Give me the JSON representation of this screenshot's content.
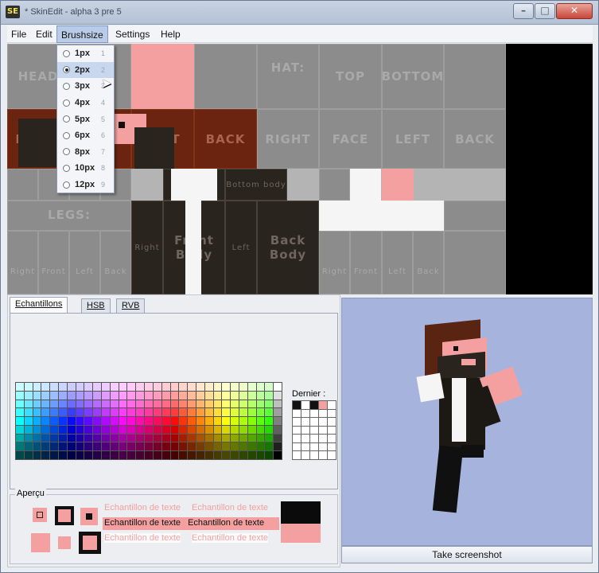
{
  "window": {
    "app_icon": "SE",
    "title": "* SkinEdit - alpha 3 pre 5",
    "minimize": "–",
    "maximize": "□",
    "close": "✕"
  },
  "menubar": {
    "items": [
      "File",
      "Edit",
      "Brushsize",
      "Settings",
      "Help"
    ]
  },
  "brush_menu": {
    "items": [
      {
        "label": "1px",
        "key": "1"
      },
      {
        "label": "2px",
        "key": "2",
        "selected": true
      },
      {
        "label": "3px",
        "key": "3"
      },
      {
        "label": "4px",
        "key": "4"
      },
      {
        "label": "5px",
        "key": "5"
      },
      {
        "label": "6px",
        "key": "6"
      },
      {
        "label": "8px",
        "key": "7"
      },
      {
        "label": "10px",
        "key": "8"
      },
      {
        "label": "12px",
        "key": "9"
      }
    ]
  },
  "skin_labels": {
    "head": "HEAD",
    "hat": "HAT:",
    "top": "TOP",
    "bottom": "BOTTOM",
    "right": "RIGHT",
    "left": "LEFT",
    "back": "BACK",
    "face": "FACE",
    "right2": "RIGHT",
    "left2": "LEFT",
    "back2": "BACK",
    "legs": "LEGS:",
    "bottom_body": "Bottom body",
    "front_body": "Front Body",
    "back_body": "Back Body",
    "body_right": "Right",
    "body_left": "Left",
    "leg_right": "Right",
    "leg_front": "Front",
    "leg_left": "Left",
    "leg_back": "Back",
    "arm_right": "Right",
    "arm_front": "Front",
    "arm_left": "Left",
    "arm_back": "Back"
  },
  "color_panel": {
    "tabs": [
      "Echantillons",
      "HSB",
      "RVB"
    ],
    "recent_label": "Dernier :",
    "apercu_label": "Aperçu",
    "sample_text": "Echantillon de texte"
  },
  "preview": {
    "screenshot_button": "Take screenshot"
  },
  "colors": {
    "skin_pink": "#f4a0a0",
    "shirt_brown": "#6b2410",
    "suit_dark": "#2a241f",
    "preview_bg": "#a6b4dd"
  }
}
